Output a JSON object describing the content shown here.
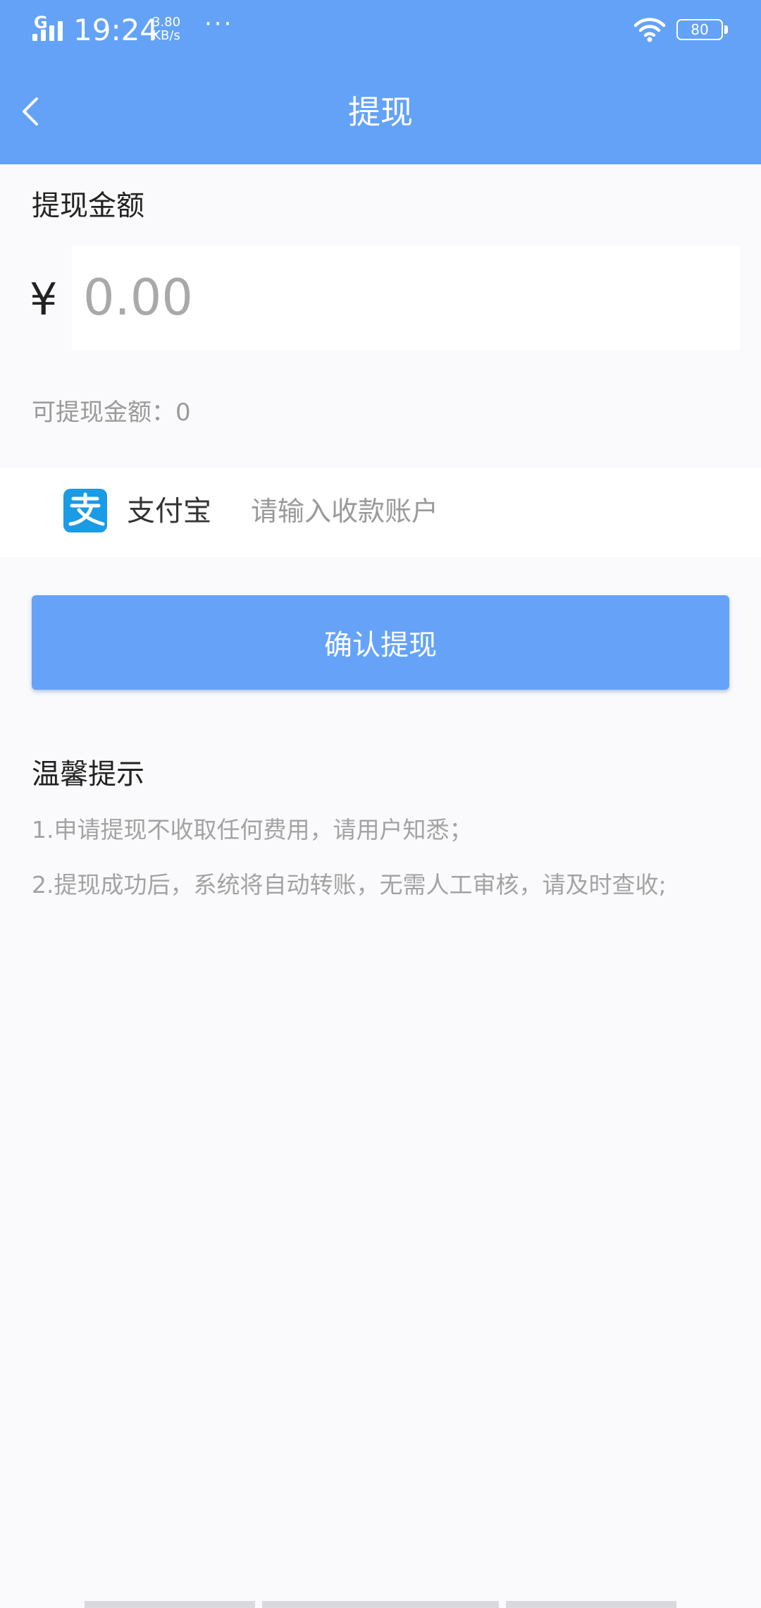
{
  "status_bar": {
    "network": "G",
    "time": "19:24",
    "speed_value": "3.80",
    "speed_unit": "KB/s",
    "more": "···",
    "battery": "80"
  },
  "header": {
    "title": "提现",
    "back_icon": "chevron-left-icon",
    "background_color": "#63a2f7"
  },
  "withdraw": {
    "amount_label": "提现金额",
    "currency_symbol": "¥",
    "amount_value": "",
    "amount_placeholder": "0.00",
    "available_label": "可提现金额：",
    "available_value": "0"
  },
  "payment": {
    "method_icon": "alipay-icon",
    "method_name": "支付宝",
    "account_value": "",
    "account_placeholder": "请输入收款账户"
  },
  "confirm_button": {
    "label": "确认提现",
    "color": "#66a3f8"
  },
  "tips": {
    "title": "温馨提示",
    "items": [
      "1.申请提现不收取任何费用，请用户知悉；",
      "2.提现成功后，系统将自动转账，无需人工审核，请及时查收;"
    ]
  }
}
